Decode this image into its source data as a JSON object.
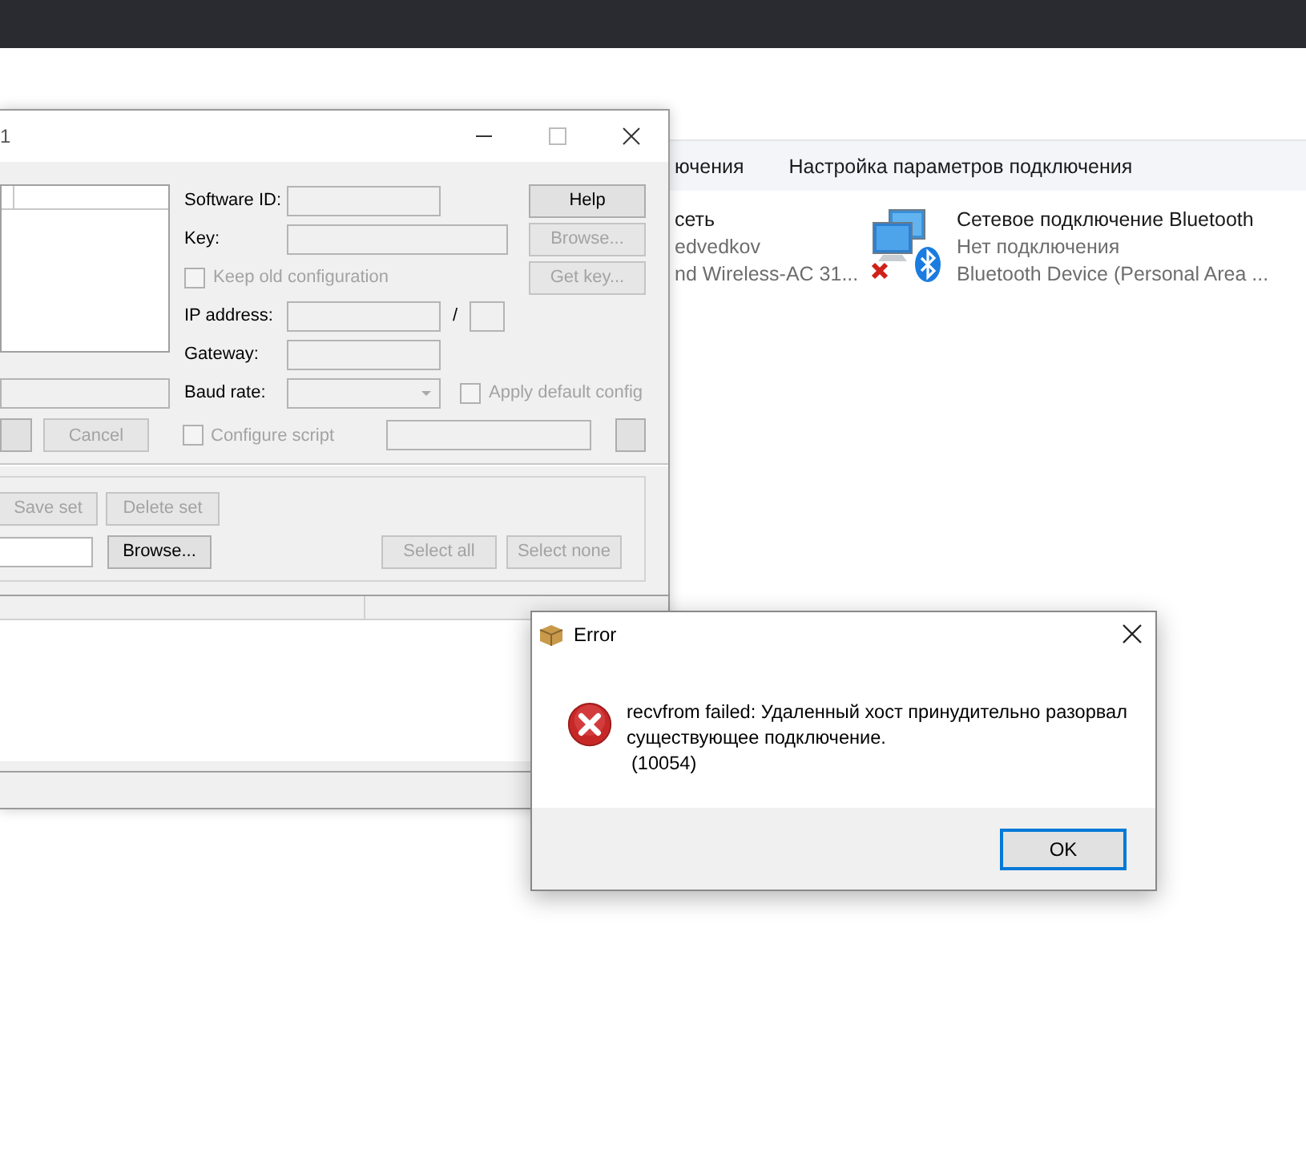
{
  "explorer": {
    "toolbar": [
      {
        "label": "ючения"
      },
      {
        "label": "Настройка параметров подключения"
      }
    ],
    "connections": [
      {
        "kind": "partial",
        "name": "сеть",
        "status": "edvedkov",
        "device": "nd Wireless-AC 31..."
      },
      {
        "kind": "bluetooth",
        "name": "Сетевое подключение Bluetooth",
        "status": "Нет подключения",
        "device": "Bluetooth Device (Personal Area ..."
      }
    ]
  },
  "config_dialog": {
    "title": "1",
    "fields": {
      "software_id": "Software ID:",
      "key": "Key:",
      "ip_address": "IP address:",
      "ip_separator": "/",
      "gateway": "Gateway:",
      "baud_rate": "Baud rate:"
    },
    "checkboxes": {
      "keep_old": {
        "label": "Keep old configuration",
        "checked": false,
        "disabled": true
      },
      "apply_default": {
        "label": "Apply default config",
        "checked": false,
        "disabled": true
      },
      "configure_script": {
        "label": "Configure script",
        "checked": false,
        "disabled": true
      }
    },
    "buttons": {
      "help": {
        "label": "Help",
        "disabled": false
      },
      "browse_key": {
        "label": "Browse...",
        "disabled": true
      },
      "get_key": {
        "label": "Get key...",
        "disabled": true
      },
      "cancel": {
        "label": "Cancel",
        "disabled": true
      },
      "save_set": {
        "label": "Save set",
        "disabled": true
      },
      "delete_set": {
        "label": "Delete set",
        "disabled": true
      },
      "browse": {
        "label": "Browse...",
        "disabled": false
      },
      "select_all": {
        "label": "Select all",
        "disabled": true
      },
      "select_none": {
        "label": "Select none",
        "disabled": true
      }
    }
  },
  "error_dialog": {
    "title": "Error",
    "message": "recvfrom failed: Удаленный хост принудительно разорвал существующее подключение.",
    "code": "(10054)",
    "ok_button": "OK"
  }
}
